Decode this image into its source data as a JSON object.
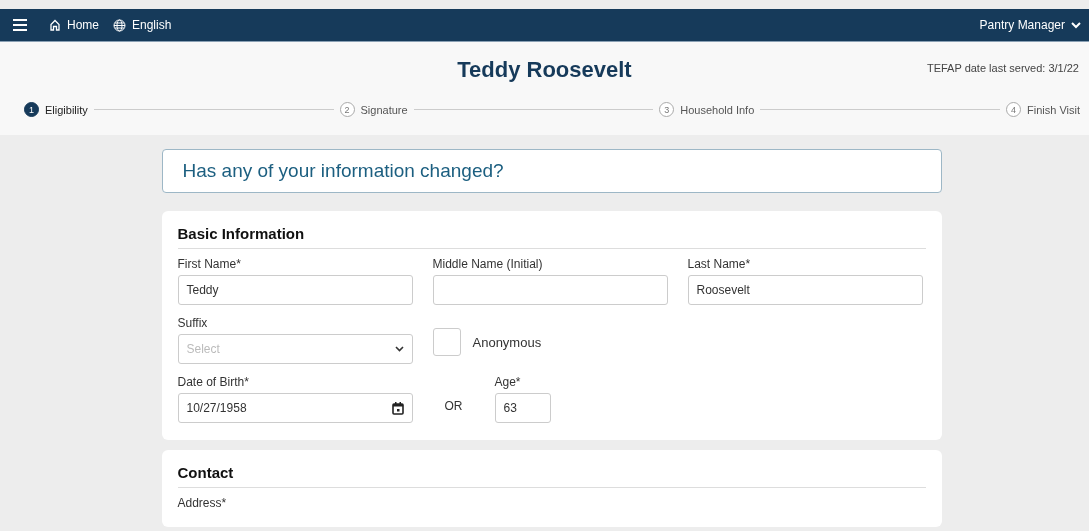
{
  "nav": {
    "home": "Home",
    "language": "English",
    "user": "Pantry Manager"
  },
  "visit": {
    "name": "Teddy Roosevelt",
    "tefap": "TEFAP date last served: 3/1/22"
  },
  "steps": [
    {
      "number": "1",
      "label": "Eligibility",
      "selected": true
    },
    {
      "number": "2",
      "label": "Signature",
      "selected": false
    },
    {
      "number": "3",
      "label": "Household Info",
      "selected": false
    },
    {
      "number": "4",
      "label": "Finish Visit",
      "selected": false
    }
  ],
  "banner": "Has any of your information changed?",
  "basic": {
    "title": "Basic Information",
    "rows": [
      [
        {
          "kind": "text",
          "label": "First Name*",
          "value": "Teddy"
        },
        {
          "kind": "text",
          "label": "Middle Name (Initial)"
        },
        {
          "kind": "text",
          "label": "Last Name*",
          "value": "Roosevelt"
        }
      ],
      [
        {
          "kind": "select",
          "label": "Suffix",
          "placeholder": "Select"
        },
        {
          "kind": "checkbox",
          "label": "Anonymous",
          "checked": false
        }
      ],
      [
        {
          "kind": "date",
          "label": "Date of Birth*",
          "value": "10/27/1958"
        },
        {
          "kind": "group",
          "items": [
            {
              "kind": "or",
              "text": "OR"
            },
            {
              "kind": "number",
              "label": "Age*",
              "value": "63"
            }
          ]
        }
      ]
    ]
  },
  "contact": {
    "title": "Contact",
    "rows": [
      [
        {
          "kind": "label",
          "label": "Address*"
        }
      ]
    ]
  }
}
